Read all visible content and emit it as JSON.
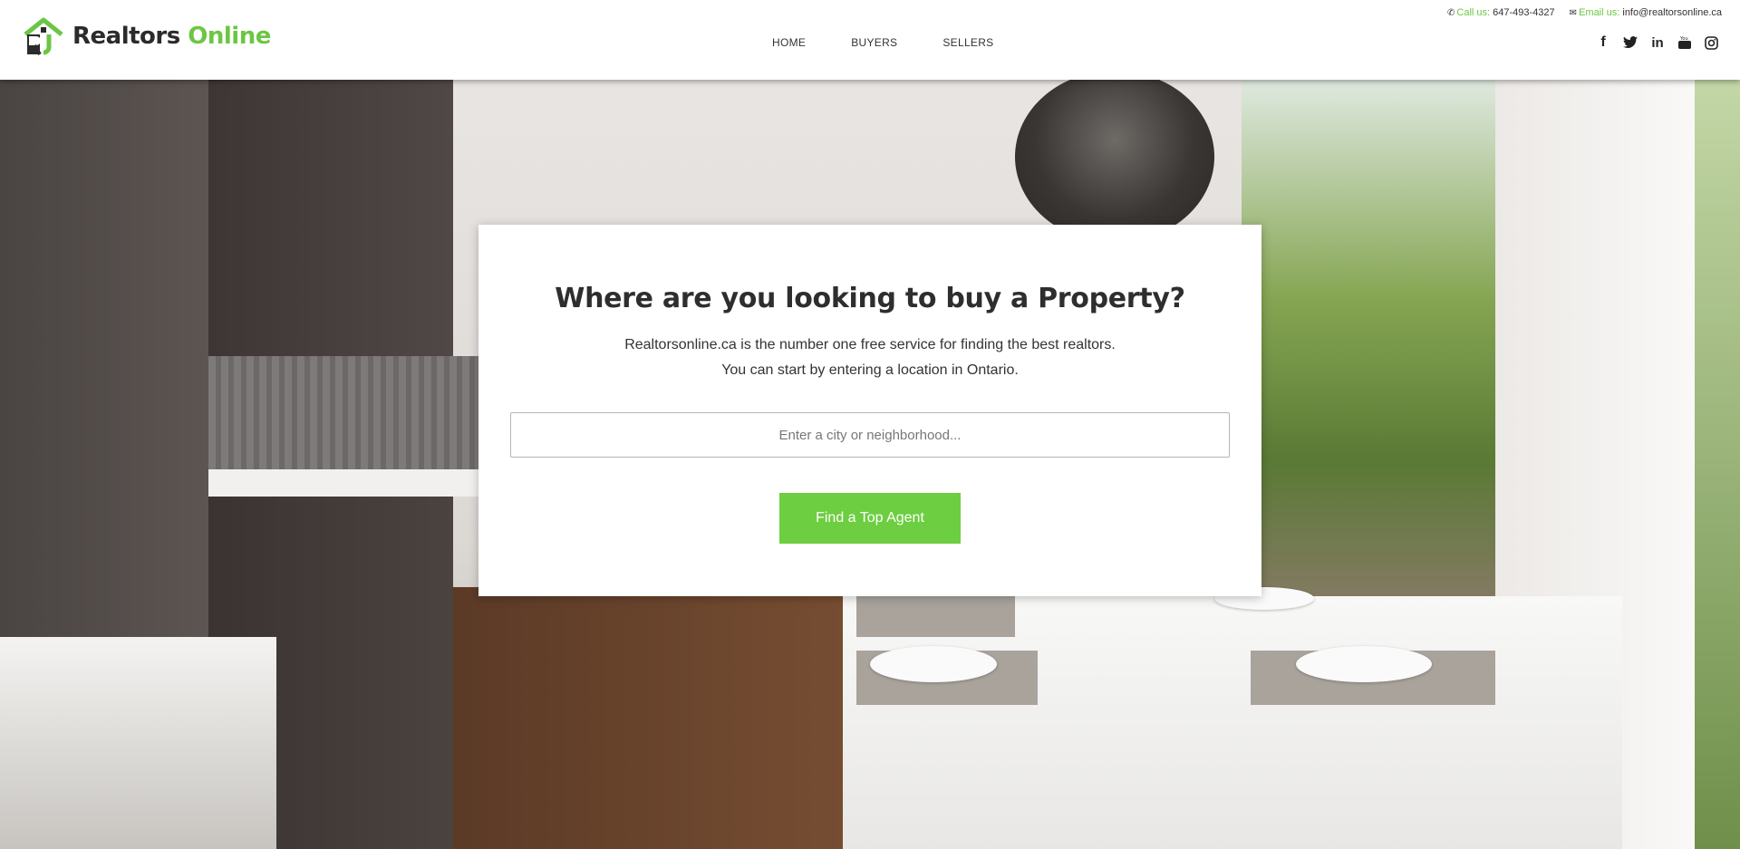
{
  "brand": {
    "name_part1": "Realtors",
    "name_part2": "Online",
    "accent": "#6cc644"
  },
  "nav": {
    "items": [
      {
        "label": "HOME"
      },
      {
        "label": "BUYERS"
      },
      {
        "label": "SELLERS"
      }
    ]
  },
  "contact": {
    "phone_label": "Call us:",
    "phone": "647-493-4327",
    "email_label": "Email us:",
    "email": "info@realtorsonline.ca"
  },
  "social": {
    "icons": [
      "facebook-icon",
      "twitter-icon",
      "linkedin-icon",
      "youtube-icon",
      "instagram-icon"
    ]
  },
  "hero": {
    "title": "Where are you looking to buy a Property?",
    "line1": "Realtorsonline.ca is the number one free service for finding the best realtors.",
    "line2": "You can start by entering a location in Ontario.",
    "search_placeholder": "Enter a city or neighborhood...",
    "cta_label": "Find a Top Agent",
    "cta_color": "#6cce40"
  }
}
